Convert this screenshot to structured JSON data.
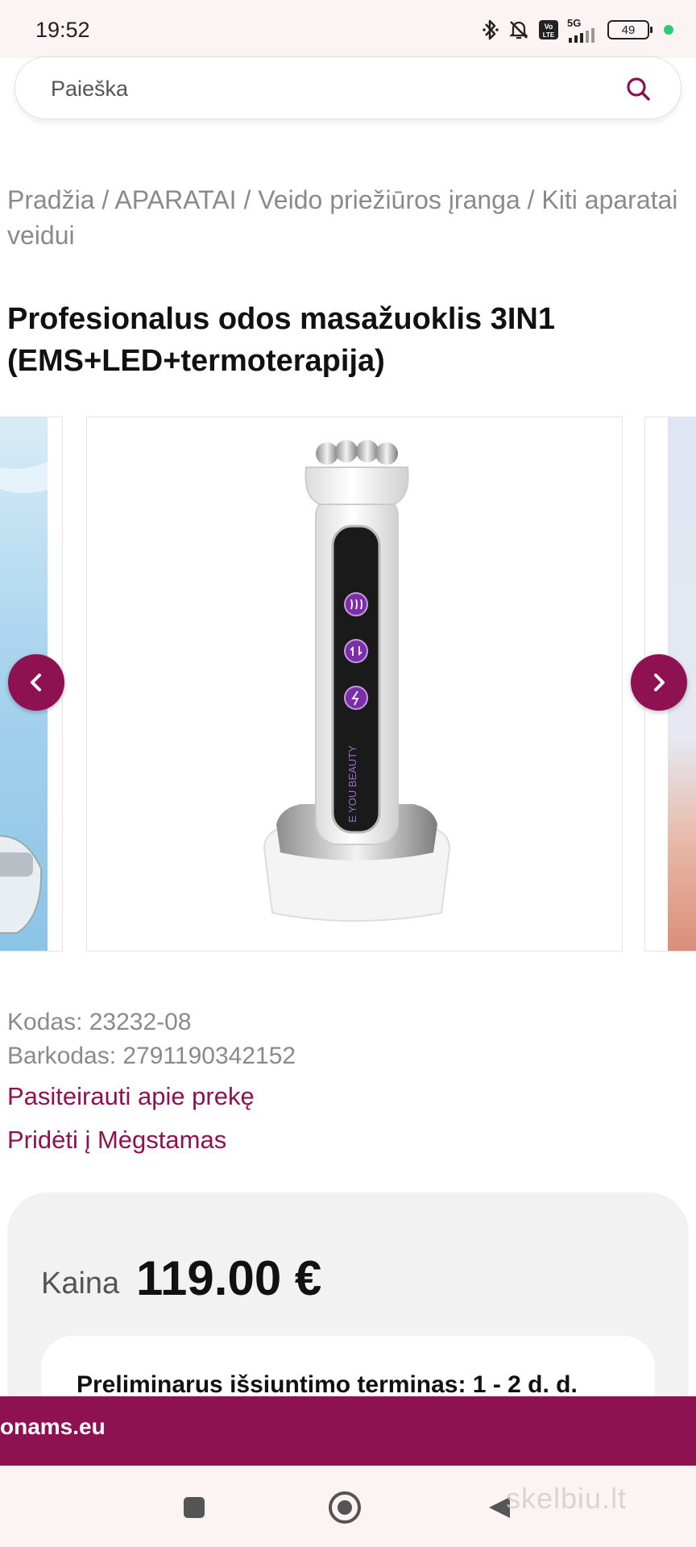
{
  "status_bar": {
    "time": "19:52",
    "network": "5G",
    "volte": "Vo LTE",
    "battery": "49",
    "icons": [
      "bluetooth-icon",
      "bell-off-icon",
      "volte-icon",
      "signal-icon",
      "battery-icon",
      "green-dot"
    ]
  },
  "search": {
    "placeholder": "Paieška",
    "icon": "search-icon"
  },
  "breadcrumb": {
    "items": [
      "Pradžia",
      "APARATAI",
      "Veido priežiūros įranga",
      "Kiti aparatai veidui"
    ],
    "separator": " / "
  },
  "product": {
    "title": "Profesionalus odos masažuoklis 3IN1 (EMS+LED+termoterapija)",
    "image_text": "E YOU BEAUTY",
    "code": "Kodas: 23232-08",
    "barcode": "Barkodas: 2791190342152",
    "inquire": "Pasiteirauti apie prekę",
    "add_favorite": "Pridėti į Mėgstamas"
  },
  "price": {
    "label": "Kaina",
    "value": "119.00 €",
    "shipping": "Preliminarus išsiuntimo terminas: 1 - 2 d. d."
  },
  "banner": {
    "text": "onams.eu"
  },
  "navbar": {
    "watermark": "skelbiu.lt",
    "buttons": [
      "recents-icon",
      "home-icon",
      "back-icon"
    ]
  },
  "colors": {
    "brand": "#8e1151",
    "status_bg": "#fbf4f2",
    "card_bg": "#f2f2f2",
    "muted_text": "#8a8a8a"
  }
}
